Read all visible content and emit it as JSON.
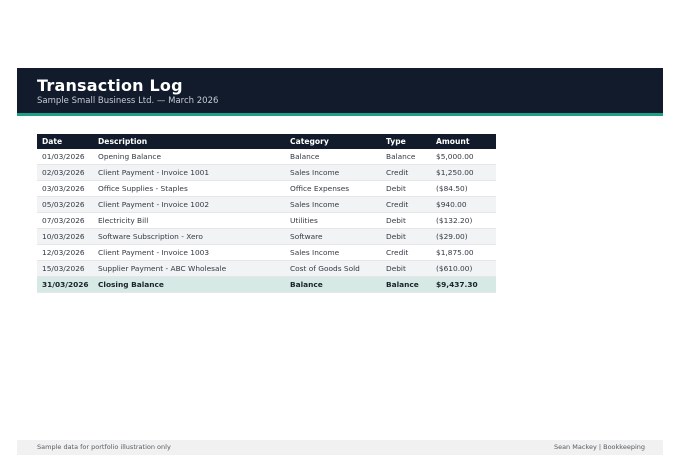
{
  "header": {
    "title": "Transaction Log",
    "subtitle": "Sample Small Business Ltd. — March 2026",
    "accent_color": "#1f9e8a",
    "background_color": "#111b2b"
  },
  "table": {
    "columns": [
      "Date",
      "Description",
      "Category",
      "Type",
      "Amount"
    ],
    "rows": [
      {
        "date": "01/03/2026",
        "description": "Opening Balance",
        "category": "Balance",
        "type": "Balance",
        "amount": "$5,000.00"
      },
      {
        "date": "02/03/2026",
        "description": "Client Payment - Invoice 1001",
        "category": "Sales Income",
        "type": "Credit",
        "amount": "$1,250.00"
      },
      {
        "date": "03/03/2026",
        "description": "Office Supplies - Staples",
        "category": "Office Expenses",
        "type": "Debit",
        "amount": "($84.50)"
      },
      {
        "date": "05/03/2026",
        "description": "Client Payment - Invoice 1002",
        "category": "Sales Income",
        "type": "Credit",
        "amount": "$940.00"
      },
      {
        "date": "07/03/2026",
        "description": "Electricity Bill",
        "category": "Utilities",
        "type": "Debit",
        "amount": "($132.20)"
      },
      {
        "date": "10/03/2026",
        "description": "Software Subscription - Xero",
        "category": "Software",
        "type": "Debit",
        "amount": "($29.00)"
      },
      {
        "date": "12/03/2026",
        "description": "Client Payment - Invoice 1003",
        "category": "Sales Income",
        "type": "Credit",
        "amount": "$1,875.00"
      },
      {
        "date": "15/03/2026",
        "description": "Supplier Payment - ABC Wholesale",
        "category": "Cost of Goods Sold",
        "type": "Debit",
        "amount": "($610.00)"
      }
    ],
    "closing": {
      "date": "31/03/2026",
      "description": "Closing Balance",
      "category": "Balance",
      "type": "Balance",
      "amount": "$9,437.30"
    }
  },
  "footer": {
    "left": "Sample data for portfolio illustration only",
    "right": "Sean Mackey | Bookkeeping"
  }
}
